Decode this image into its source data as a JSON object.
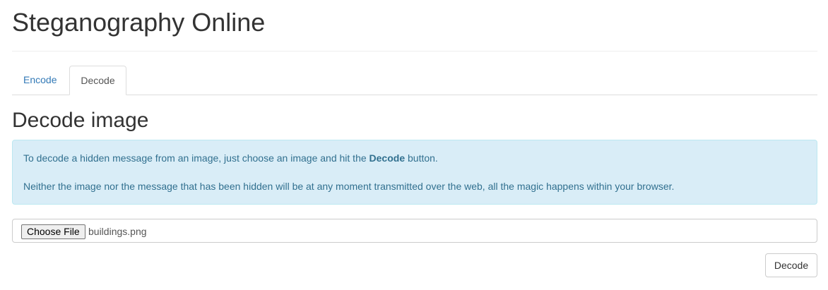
{
  "header": {
    "title": "Steganography Online"
  },
  "tabs": [
    {
      "label": "Encode",
      "active": false
    },
    {
      "label": "Decode",
      "active": true
    }
  ],
  "main": {
    "section_title": "Decode image",
    "info": {
      "line1_before": "To decode a hidden message from an image, just choose an image and hit the ",
      "line1_bold": "Decode",
      "line1_after": " button.",
      "line2": "Neither the image nor the message that has been hidden will be at any moment transmitted over the web, all the magic happens within your browser."
    },
    "file_input": {
      "button_label": "Choose File",
      "file_name": "buildings.png"
    },
    "decode_button_label": "Decode"
  },
  "colors": {
    "link": "#337ab7",
    "info_background": "#d9edf7",
    "info_border": "#bce8f1",
    "info_text": "#31708f",
    "heading_text": "#333333"
  }
}
